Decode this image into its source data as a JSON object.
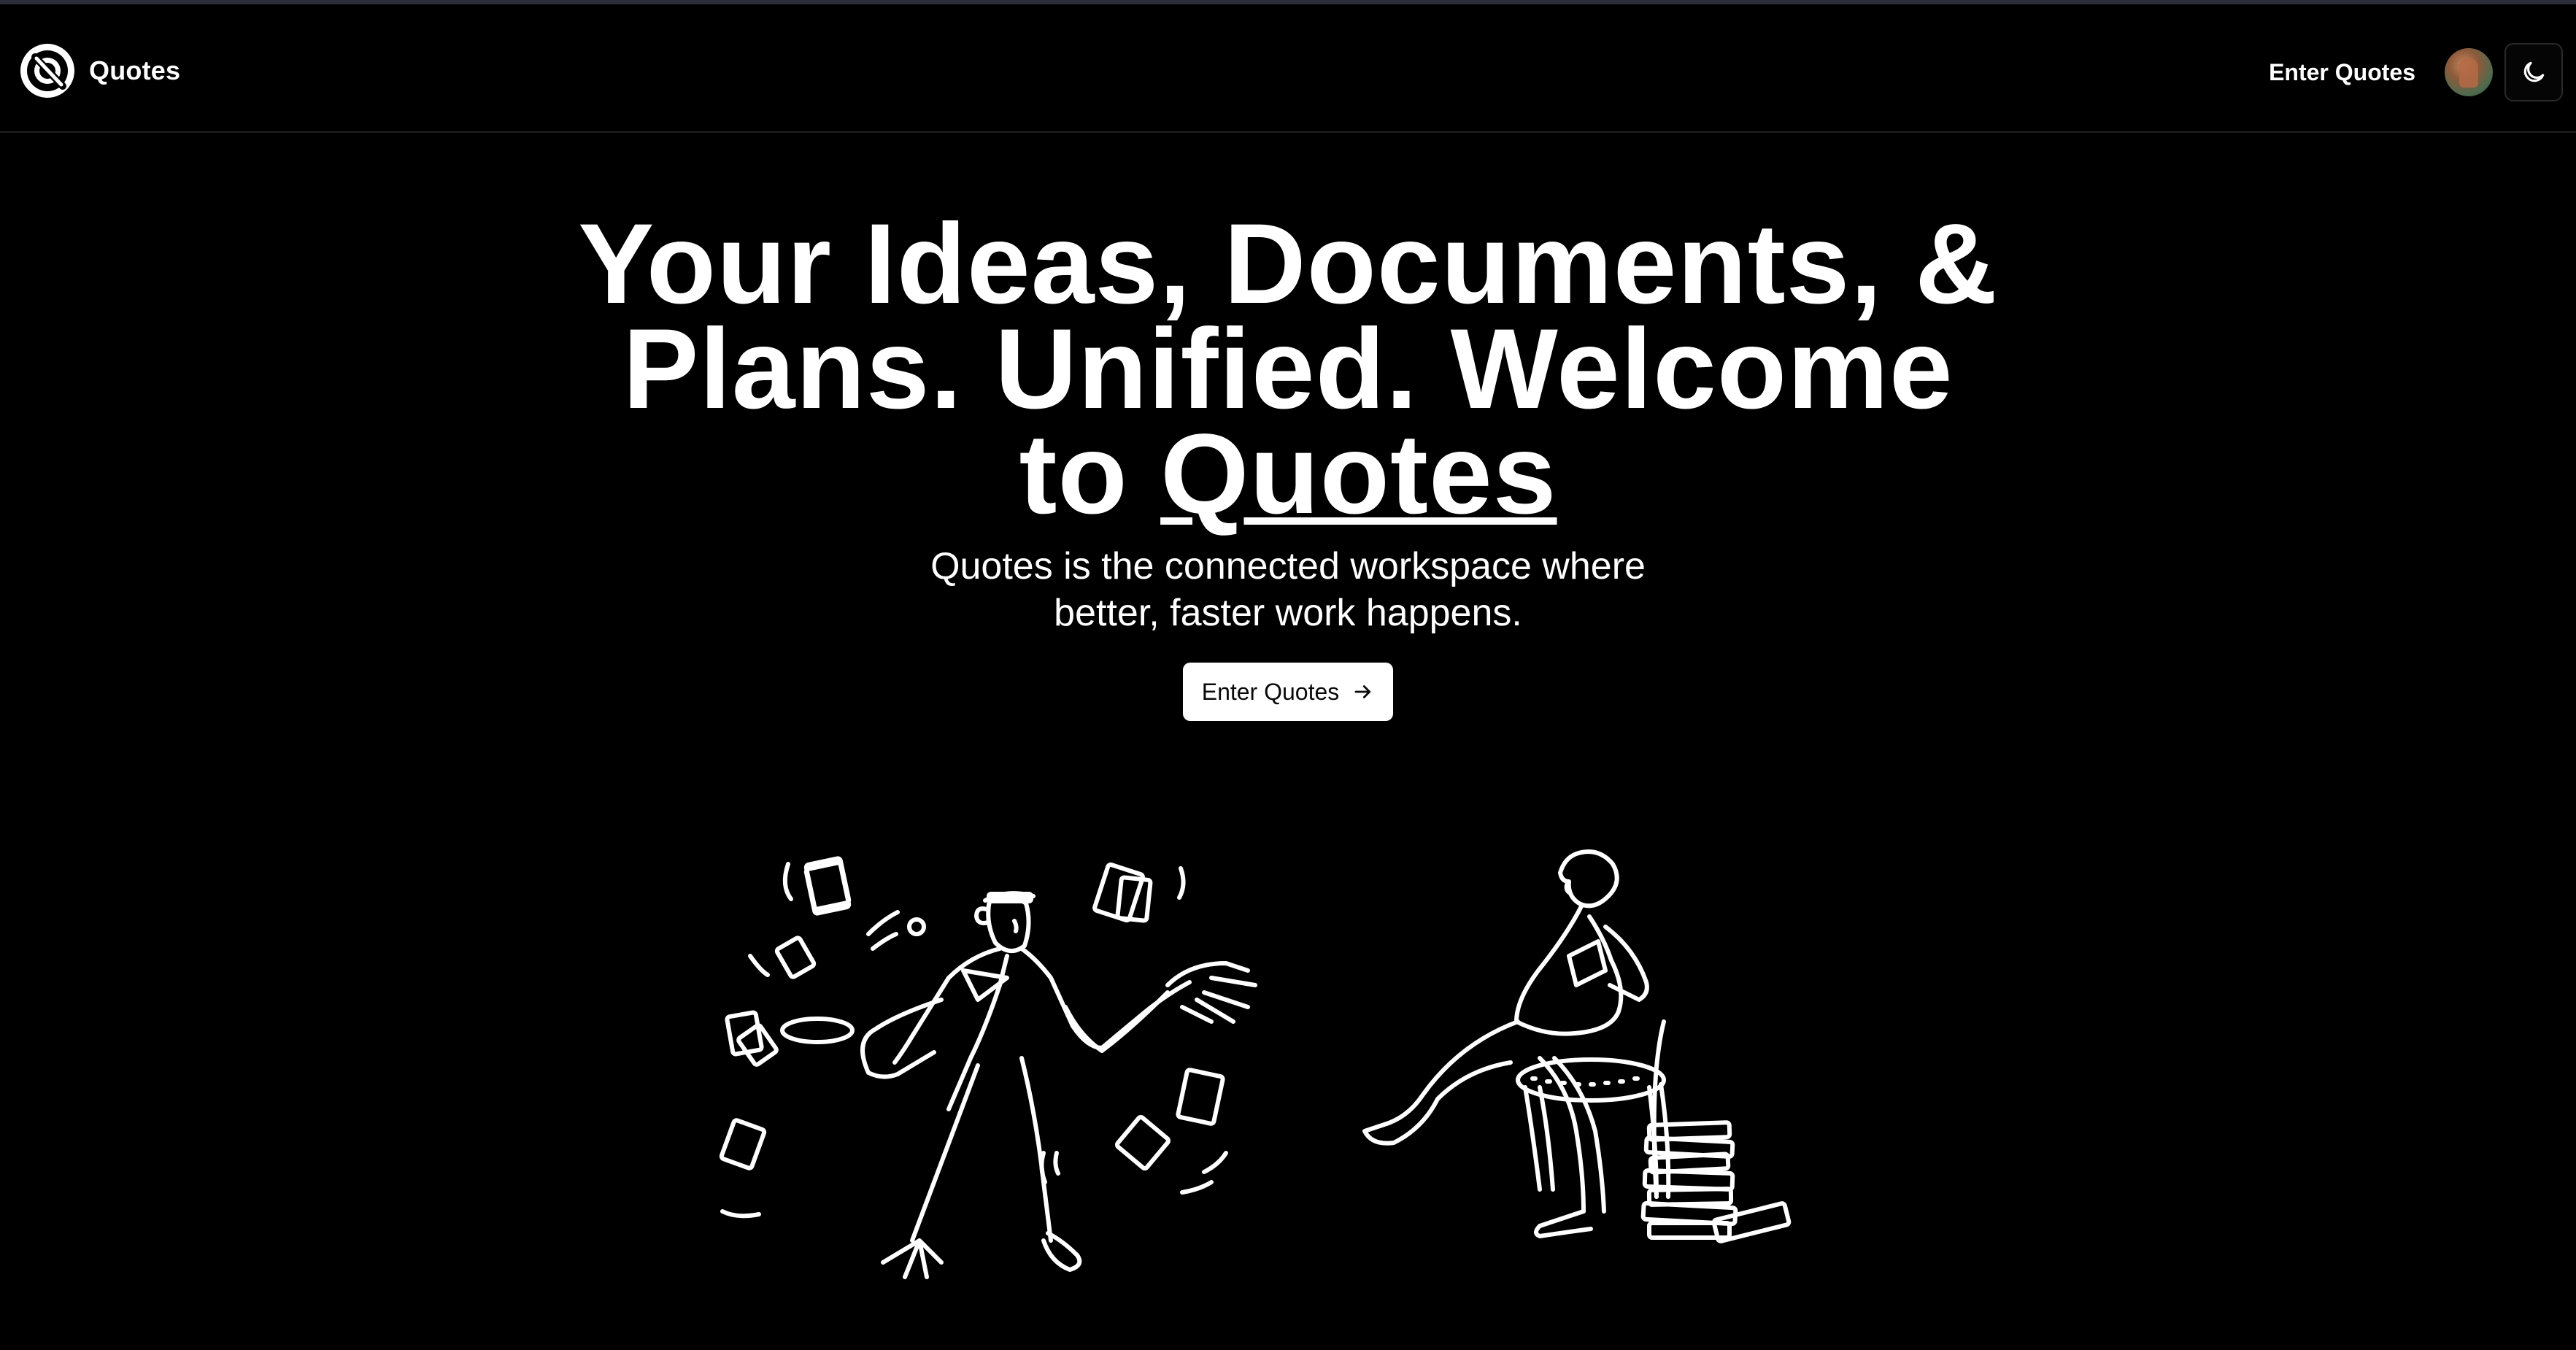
{
  "header": {
    "brand_name": "Quotes",
    "nav_link": "Enter Quotes",
    "logo_icon": "quotes-logo-icon",
    "avatar_icon": "user-avatar",
    "theme_icon": "moon-icon"
  },
  "hero": {
    "title_line_1": "Your Ideas, Documents, &",
    "title_line_2": "Plans. Unified. Welcome",
    "title_to": "to",
    "title_brand": "Quotes",
    "subtitle_line_1": "Quotes is the connected workspace where",
    "subtitle_line_2": "better, faster work happens.",
    "cta_label": "Enter Quotes",
    "cta_icon": "arrow-right-icon"
  },
  "colors": {
    "background": "#000000",
    "text": "#ffffff",
    "button_bg": "#ffffff",
    "button_text": "#0a0a0a",
    "divider": "#1f1f1f"
  }
}
